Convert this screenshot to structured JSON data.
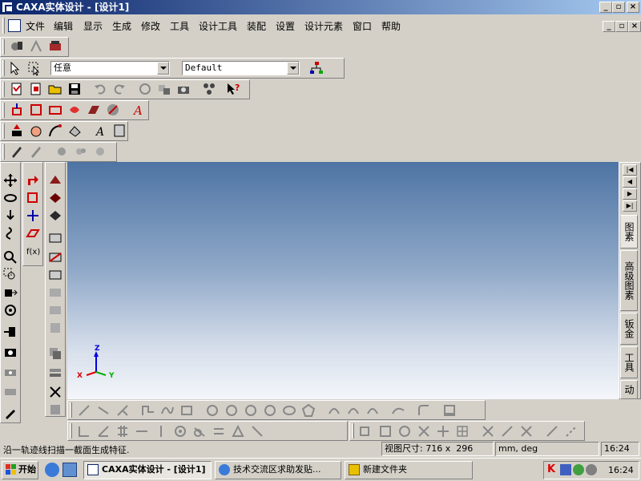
{
  "window": {
    "title": "CAXA实体设计 - [设计1]",
    "controls": {
      "minimize": "_",
      "restore": "▫",
      "close": "×"
    }
  },
  "menubar": {
    "items": [
      "文件",
      "编辑",
      "显示",
      "生成",
      "修改",
      "工具",
      "设计工具",
      "装配",
      "设置",
      "设计元素",
      "窗口",
      "帮助"
    ],
    "mdi_controls": {
      "minimize": "_",
      "restore": "▫",
      "close": "×"
    }
  },
  "selection_toolbar": {
    "filter_combo": "任意",
    "style_combo": "Default"
  },
  "right_panel": {
    "nav_arrows": [
      "|◀",
      "◀",
      "▶",
      "▶|"
    ],
    "tabs": [
      "图素",
      "高级图素",
      "钣金",
      "工具",
      "动"
    ]
  },
  "viewport": {
    "axis_labels": {
      "x": "X",
      "y": "Y",
      "z": "Z"
    },
    "colors": {
      "x": "#e00000",
      "y": "#00b000",
      "z": "#0000e0",
      "bg_top": "#4e74a4",
      "bg_bottom": "#f4f6fa"
    }
  },
  "statusbar": {
    "message": "沿一轨迹线扫描一截面生成特征.",
    "view_size_label": "视图尺寸:",
    "view_size_value": "716 x  296",
    "units": "mm, deg",
    "time": "16:24"
  },
  "taskbar": {
    "start_label": "开始",
    "tasks": [
      {
        "label": "CAXA实体设计 - [设计1]",
        "active": true,
        "icon": "caxa-app-icon"
      },
      {
        "label": "技术交流区求助发贴...",
        "active": false,
        "icon": "ie-icon"
      },
      {
        "label": "新建文件夹",
        "active": false,
        "icon": "folder-icon"
      }
    ],
    "clock": "16:24"
  }
}
